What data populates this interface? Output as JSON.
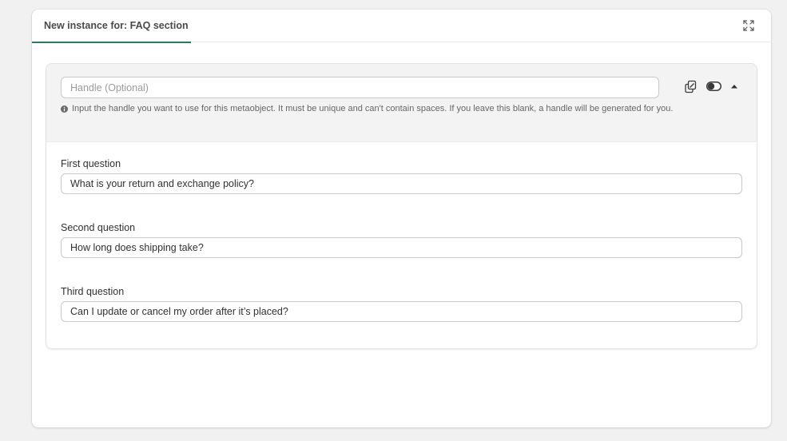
{
  "modal": {
    "tab_label": "New instance for: FAQ section",
    "expand_icon": "expand-icon"
  },
  "entry": {
    "handle": {
      "placeholder": "Handle (Optional)",
      "value": "",
      "help_text": "Input the handle you want to use for this metaobject. It must be unique and can't contain spaces. If you leave this blank, a handle will be generated for you."
    },
    "actions": {
      "duplicate_icon": "duplicate-icon",
      "toggle_icon": "toggle-icon",
      "collapse_icon": "caret-up-icon"
    },
    "fields": [
      {
        "label": "First question",
        "value": "What is your return and exchange policy?"
      },
      {
        "label": "Second question",
        "value": "How long does shipping take?"
      },
      {
        "label": "Third question",
        "value": "Can I update or cancel my order after it’s placed?"
      }
    ]
  },
  "colors": {
    "accent": "#2c7a5c",
    "background": "#f1f1f1",
    "header_bg": "#f3f3f3"
  }
}
